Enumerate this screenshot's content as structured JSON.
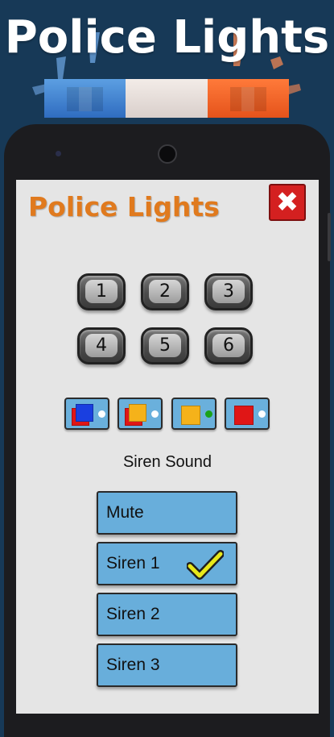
{
  "banner": {
    "title": "Police Lights"
  },
  "app": {
    "title": "Police Lights",
    "close_icon": "close-x-icon",
    "pattern_buttons": [
      "1",
      "2",
      "3",
      "4",
      "5",
      "6"
    ],
    "color_modes": [
      {
        "name": "blue-red",
        "colors": [
          "#1a3fe0",
          "#e01616"
        ],
        "dot": "#ffffff"
      },
      {
        "name": "red-yellow",
        "colors": [
          "#e01616",
          "#f5b21a"
        ],
        "dot": "#ffffff"
      },
      {
        "name": "yellow-green",
        "colors": [
          "#f5b21a"
        ],
        "dot": "#1aa21a"
      },
      {
        "name": "red",
        "colors": [
          "#e01616"
        ],
        "dot": "#ffffff"
      }
    ],
    "siren_label": "Siren Sound",
    "sounds": [
      {
        "label": "Mute",
        "selected": false
      },
      {
        "label": "Siren 1",
        "selected": true
      },
      {
        "label": "Siren 2",
        "selected": false
      },
      {
        "label": "Siren 3",
        "selected": false
      }
    ]
  },
  "colors": {
    "accent_orange": "#e07a1e",
    "button_blue": "#68aedb",
    "close_red": "#d42020",
    "background_navy": "#173957",
    "check_yellow": "#e8e81a"
  }
}
